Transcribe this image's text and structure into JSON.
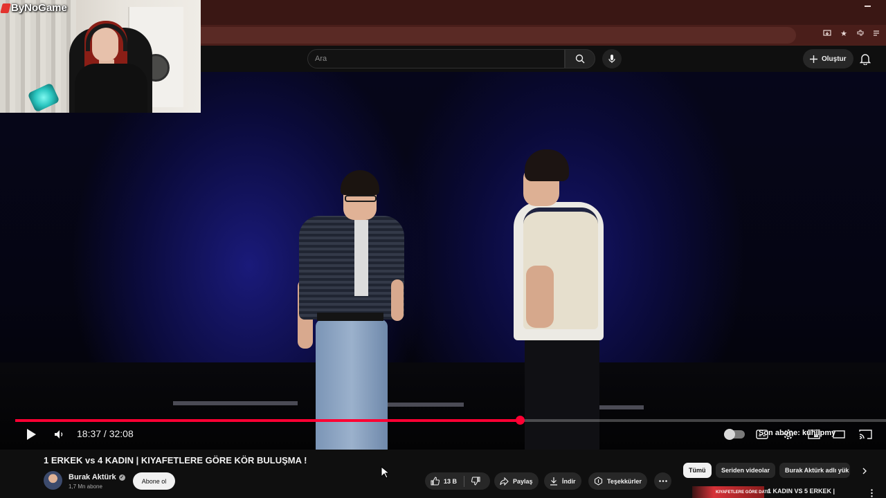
{
  "webcam": {
    "logo_text": "ByNoGame"
  },
  "header": {
    "search_placeholder": "Ara",
    "create_label": "Oluştur"
  },
  "player": {
    "current_time": "18:37",
    "duration": "32:08",
    "time_display": "18:37 / 32:08",
    "progress_fraction": 0.5795,
    "overlay_text": "Son abone: kuhiipmy"
  },
  "video": {
    "title": "1 ERKEK vs 4 KADIN | KIYAFETLERE GÖRE KÖR BULUŞMA !",
    "channel_name": "Burak Aktürk",
    "subscriber_count": "1,7 Mn abone",
    "subscribe_label": "Abone ol",
    "like_count": "13 B",
    "share_label": "Paylaş",
    "download_label": "İndir",
    "thanks_label": "Teşekkürler"
  },
  "chips": [
    {
      "label": "Tümü",
      "active": true
    },
    {
      "label": "Seriden videolar",
      "active": false
    },
    {
      "label": "Burak Aktürk adlı yük",
      "active": false
    }
  ],
  "recommendation": {
    "thumb_text": "KIYAFETLERE GÖRE DATE",
    "title": "1 KADIN VS 5 ERKEK |"
  },
  "colors": {
    "accent_red": "#ff0033",
    "chrome_red": "#3a1714",
    "page_bg": "#0f0f0f"
  }
}
